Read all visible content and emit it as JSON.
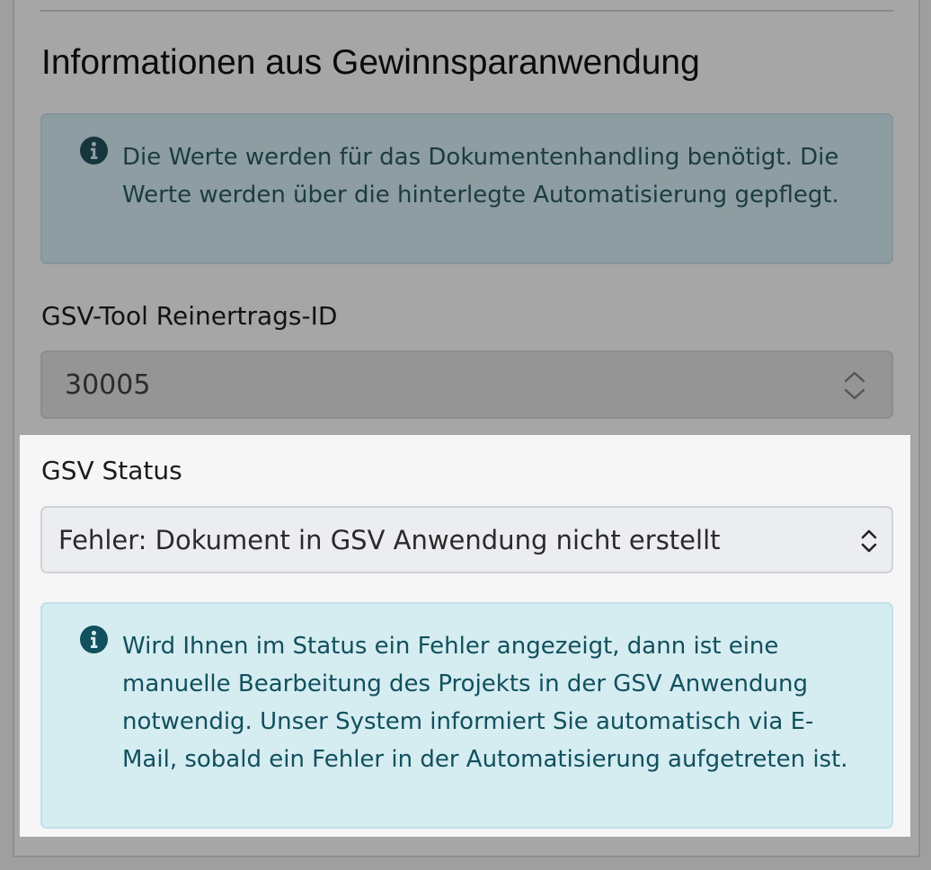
{
  "section": {
    "heading": "Informationen aus Gewinnsparanwendung"
  },
  "info_notice": {
    "icon": "info-circle-icon",
    "text": "Die Werte werden für das Dokumentenhandling benötigt. Die Werte werden über die hinterlegte Automatisierung gepflegt."
  },
  "reinertrags_field": {
    "label": "GSV-Tool Reinertrags-ID",
    "value": "30005"
  },
  "status_field": {
    "label": "GSV Status",
    "selected": "Fehler: Dokument in GSV Anwendung nicht erstellt"
  },
  "status_notice": {
    "icon": "info-circle-icon",
    "text": "Wird Ihnen im Status ein Fehler angezeigt, dann ist eine manuelle Bearbeitung des Projekts in der GSV Anwendung notwendig. Unser System informiert Sie automatisch via E-Mail, sobald ein Fehler in der Automatisierung aufgetreten ist."
  },
  "colors": {
    "overlay_gray": "#a6a6a6",
    "highlight_bg": "#f6f6f6",
    "alert_info_bg": "#d5ecf1",
    "alert_info_text": "#11505d"
  }
}
